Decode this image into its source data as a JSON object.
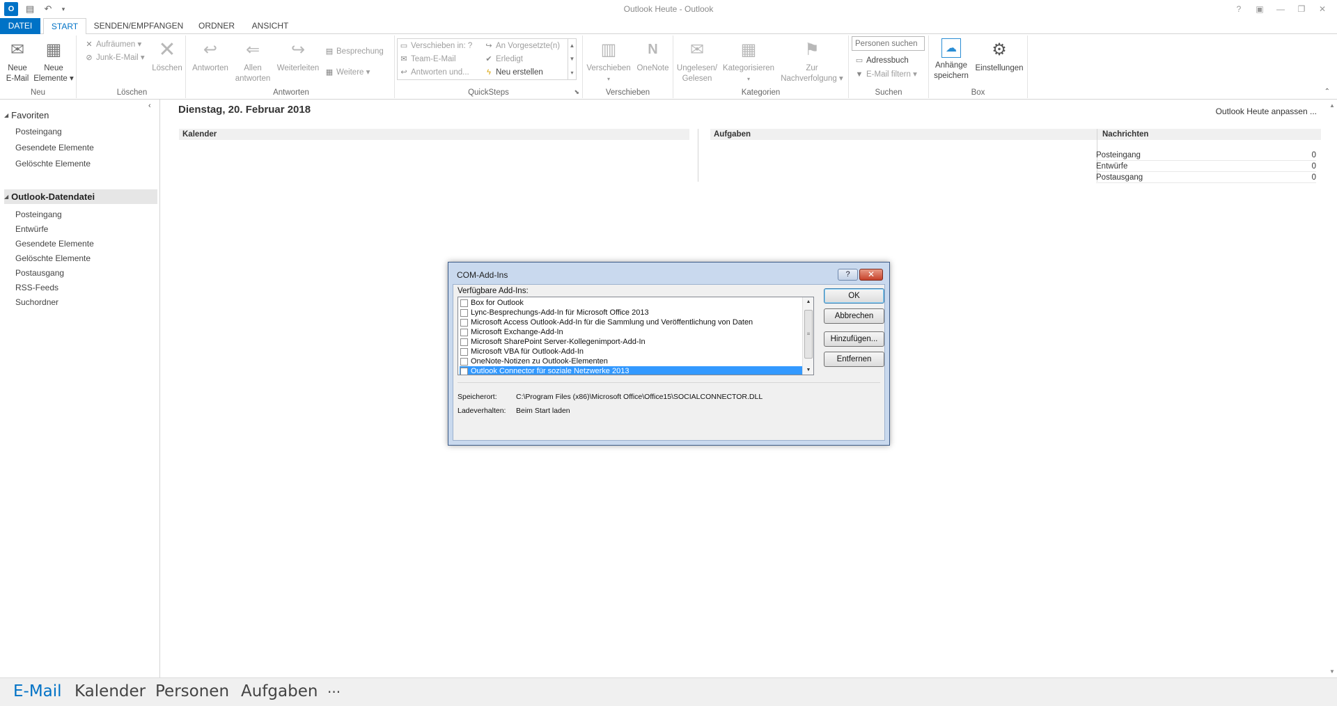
{
  "window": {
    "title": "Outlook Heute - Outlook",
    "controls": [
      "?",
      "▣",
      "—",
      "❐",
      "✕"
    ]
  },
  "tabs": [
    {
      "label": "DATEI"
    },
    {
      "label": "START"
    },
    {
      "label": "SENDEN/EMPFANGEN"
    },
    {
      "label": "ORDNER"
    },
    {
      "label": "ANSICHT"
    }
  ],
  "ribbon": {
    "neu": {
      "group": "Neu",
      "new_email": [
        "Neue",
        "E-Mail"
      ],
      "new_items": [
        "Neue",
        "Elemente ▾"
      ]
    },
    "loeschen": {
      "group": "Löschen",
      "aufraeumen": "Aufräumen ▾",
      "junk": "Junk-E-Mail ▾",
      "delete": "Löschen"
    },
    "antworten": {
      "group": "Antworten",
      "reply": "Antworten",
      "reply_all": [
        "Allen",
        "antworten"
      ],
      "forward": "Weiterleiten",
      "meeting": "Besprechung",
      "more": "Weitere ▾"
    },
    "quicksteps": {
      "group": "QuickSteps",
      "move_to": "Verschieben in: ?",
      "to_manager": "An Vorgesetzte(n)",
      "team_email": "Team-E-Mail",
      "done": "Erledigt",
      "reply_delete": "Antworten und...",
      "create_new": "Neu erstellen"
    },
    "verschieben": {
      "group": "Verschieben",
      "move": [
        "Verschieben",
        "▾"
      ],
      "onenote": "OneNote"
    },
    "kategorien": {
      "group": "Kategorien",
      "unread": [
        "Ungelesen/",
        "Gelesen"
      ],
      "categorize": [
        "Kategorisieren",
        "▾"
      ],
      "followup": [
        "Zur",
        "Nachverfolgung ▾"
      ]
    },
    "suchen": {
      "group": "Suchen",
      "search_people_placeholder": "Personen suchen",
      "address_book": "Adressbuch",
      "filter_email": "E-Mail filtern ▾"
    },
    "box": {
      "group": "Box",
      "save_attachments": [
        "Anhänge",
        "speichern"
      ],
      "settings": "Einstellungen"
    }
  },
  "nav": {
    "favorites": {
      "title": "Favoriten",
      "items": [
        "Posteingang",
        "Gesendete Elemente",
        "Gelöschte Elemente"
      ]
    },
    "datafile": {
      "title": "Outlook-Datendatei",
      "items": [
        "Posteingang",
        "Entwürfe",
        "Gesendete Elemente",
        "Gelöschte Elemente",
        "Postausgang",
        "RSS-Feeds",
        "Suchordner"
      ]
    }
  },
  "today": {
    "date": "Dienstag, 20. Februar 2018",
    "customize": "Outlook Heute anpassen ...",
    "calendar_header": "Kalender",
    "tasks_header": "Aufgaben",
    "messages_header": "Nachrichten",
    "messages": [
      {
        "label": "Posteingang",
        "count": "0"
      },
      {
        "label": "Entwürfe",
        "count": "0"
      },
      {
        "label": "Postausgang",
        "count": "0"
      }
    ]
  },
  "bottom_nav": {
    "items": [
      "E-Mail",
      "Kalender",
      "Personen",
      "Aufgaben",
      "···"
    ],
    "active": "E-Mail"
  },
  "dialog": {
    "title": "COM-Add-Ins",
    "help": "?",
    "close": "✕",
    "available_label": "Verfügbare Add-Ins:",
    "addins": [
      {
        "name": "Box for Outlook",
        "checked": false
      },
      {
        "name": "Lync-Besprechungs-Add-In für Microsoft Office 2013",
        "checked": false
      },
      {
        "name": "Microsoft Access Outlook-Add-In für die Sammlung und Veröffentlichung von Daten",
        "checked": false
      },
      {
        "name": "Microsoft Exchange-Add-In",
        "checked": false
      },
      {
        "name": "Microsoft SharePoint Server-Kollegenimport-Add-In",
        "checked": false
      },
      {
        "name": "Microsoft VBA für Outlook-Add-In",
        "checked": false
      },
      {
        "name": "OneNote-Notizen zu Outlook-Elementen",
        "checked": false
      },
      {
        "name": "Outlook Connector für soziale Netzwerke 2013",
        "checked": false,
        "selected": true
      }
    ],
    "buttons": {
      "ok": "OK",
      "cancel": "Abbrechen",
      "add": "Hinzufügen...",
      "remove": "Entfernen"
    },
    "location_label": "Speicherort:",
    "location_value": "C:\\Program Files (x86)\\Microsoft Office\\Office15\\SOCIALCONNECTOR.DLL",
    "load_label": "Ladeverhalten:",
    "load_value": "Beim Start laden"
  },
  "colors": {
    "accent": "#0072c6",
    "selection": "#3399ff",
    "dialog_frame": "#c9d9ee"
  }
}
